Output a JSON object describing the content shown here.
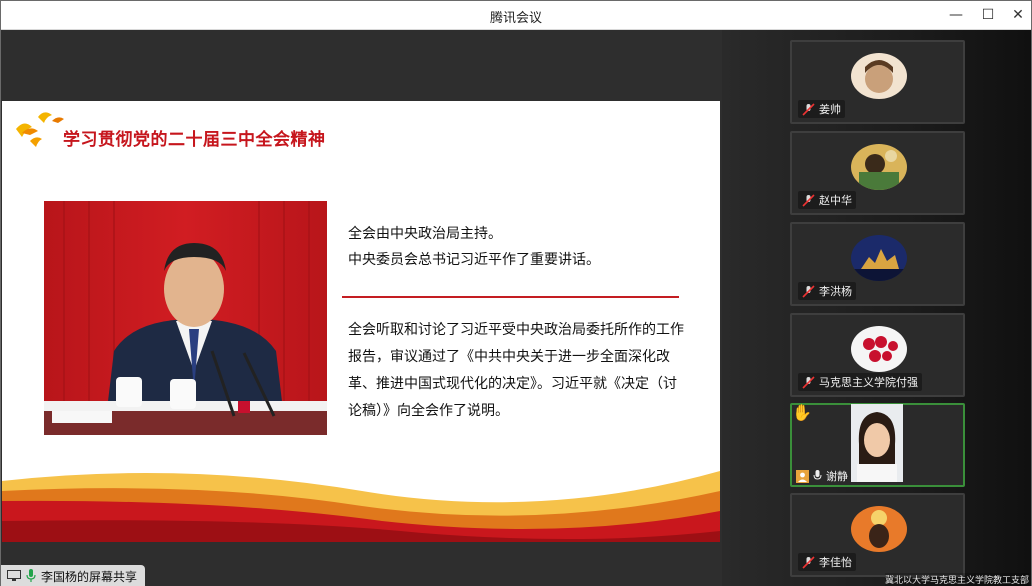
{
  "window": {
    "title": "腾讯会议",
    "minimize_glyph": "—",
    "maximize_glyph": "☐",
    "close_glyph": "✕"
  },
  "slide": {
    "title": "学习贯彻党的二十届三中全会精神",
    "line1": "全会由中央政治局主持。",
    "line2": "中央委员会总书记习近平作了重要讲话。",
    "paragraph": "全会听取和讨论了习近平受中央政治局委托所作的工作报告，审议通过了《中共中央关于进一步全面深化改革、推进中国式现代化的决定》。习近平就《决定（讨论稿）》向全会作了说明。",
    "accent_color": "#c6161d"
  },
  "share_bar": {
    "label": "李国杨的屏幕共享"
  },
  "participants": [
    {
      "name": "姜帅",
      "muted": true,
      "icon": "mic-muted-icon"
    },
    {
      "name": "赵中华",
      "muted": true,
      "icon": "mic-muted-icon"
    },
    {
      "name": "李洪杨",
      "muted": true,
      "icon": "mic-muted-icon"
    },
    {
      "name": "马克思主义学院付强",
      "muted": true,
      "icon": "mic-muted-icon"
    },
    {
      "name": "谢静",
      "muted": false,
      "hand_raised": true,
      "icon": "mic-icon"
    },
    {
      "name": "李佳怡",
      "muted": true,
      "icon": "mic-muted-icon"
    }
  ],
  "bottom_caption": "冀北以大学马克思主义学院教工支部"
}
